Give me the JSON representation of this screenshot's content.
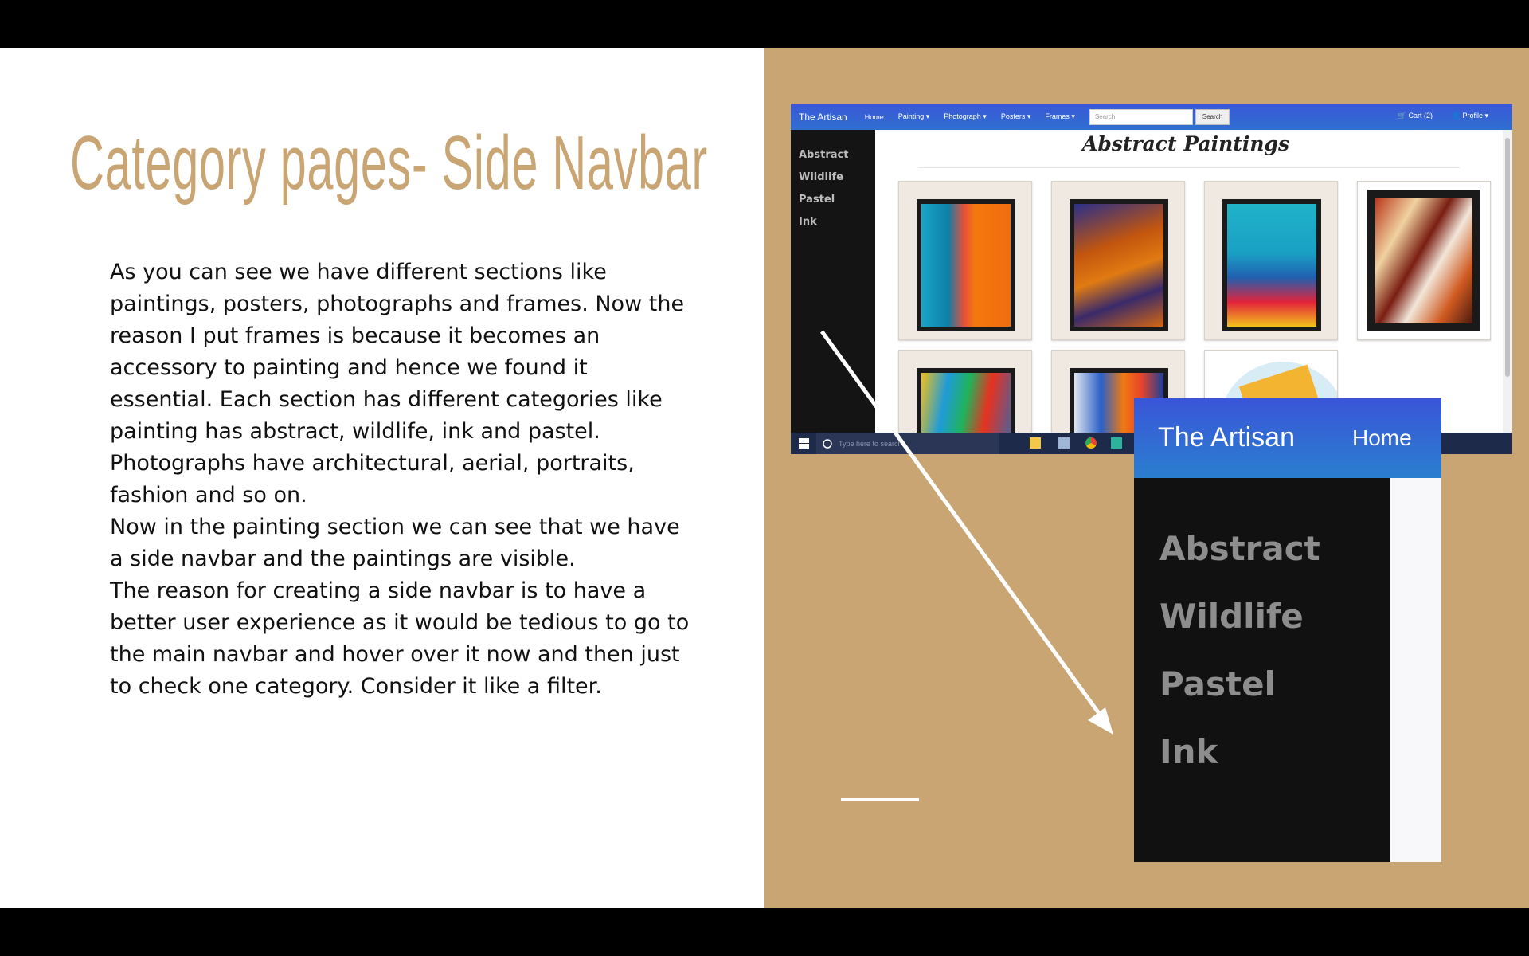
{
  "slide": {
    "title": "Category pages- Side Navbar",
    "paragraphs": [
      "As you can see we have different sections like paintings, posters, photographs and frames. Now the reason I put frames is because it becomes an accessory to painting and hence we found it essential. Each section has different categories like painting has abstract, wildlife, ink and pastel. Photographs have architectural, aerial, portraits, fashion and so on.",
      "Now in the painting section we can see that we have a side navbar and the paintings are visible.",
      "The reason for creating a side navbar is to have a better user experience as it would be tedious to go to the main navbar and hover over it now and then just to check one category. Consider it like a filter."
    ]
  },
  "screenshot": {
    "brand": "The Artisan",
    "nav": [
      "Home",
      "Painting ▾",
      "Photograph ▾",
      "Posters ▾",
      "Frames ▾"
    ],
    "search_placeholder": "Search",
    "search_button": "Search",
    "cart": "🛒 Cart (2)",
    "profile": "👤 Profile ▾",
    "side_items": [
      "Abstract",
      "Wildlife",
      "Pastel",
      "Ink"
    ],
    "heading": "Abstract Paintings",
    "taskbar_search": "Type here to search"
  },
  "zoom": {
    "brand": "The Artisan",
    "home": "Home",
    "side_items": [
      "Abstract",
      "Wildlife",
      "Pastel",
      "Ink"
    ]
  },
  "colors": {
    "accent": "#c9a574",
    "navbar": "#3b57d8",
    "sidebar": "#111111"
  }
}
